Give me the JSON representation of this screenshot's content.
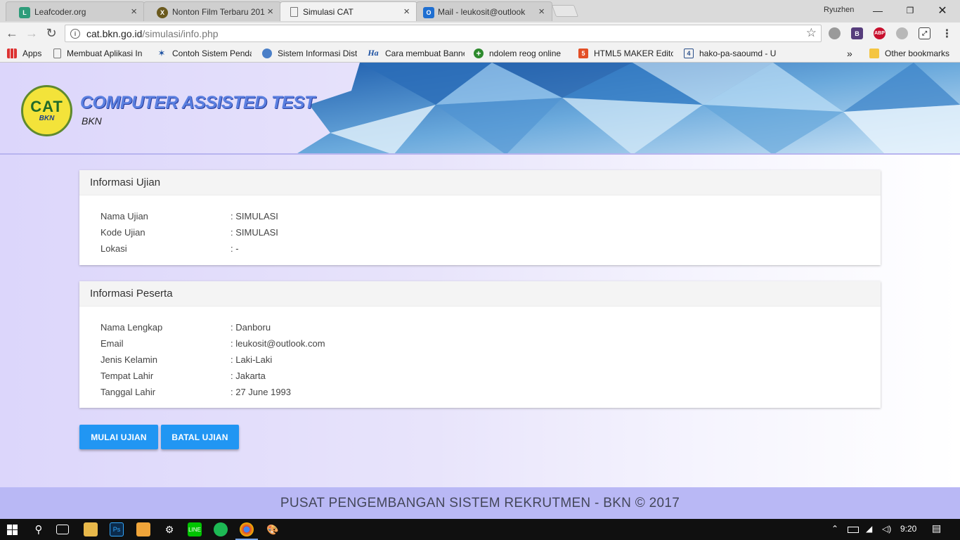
{
  "browser": {
    "tabs": [
      {
        "label": "Leafcoder.org",
        "icon": "leafcoder-icon",
        "color": "#2e9c7a",
        "active": false
      },
      {
        "label": "Nonton Film Terbaru 201",
        "icon": "film-icon",
        "color": "#6b5a1e",
        "active": false
      },
      {
        "label": "Simulasi CAT",
        "icon": "page-icon",
        "color": "#999999",
        "active": true
      },
      {
        "label": "Mail - leukosit@outlook",
        "icon": "outlook-icon",
        "color": "#1f6fd1",
        "active": false
      }
    ],
    "user": "Ryuzhen",
    "url": {
      "host": "cat.bkn.go.id",
      "path": "/simulasi/info.php"
    },
    "bookmarks": [
      {
        "label": "Apps",
        "icon": "apps-icon"
      },
      {
        "label": "Membuat Aplikasi In",
        "icon": "page-icon"
      },
      {
        "label": "Contoh Sistem Penda",
        "icon": "star-icon"
      },
      {
        "label": "Sistem Informasi Dist",
        "icon": "globe-icon"
      },
      {
        "label": "Cara membuat Banne",
        "icon": "ha-icon"
      },
      {
        "label": "ndolem reog online",
        "icon": "plus-icon"
      },
      {
        "label": "HTML5 MAKER Edito",
        "icon": "html5-icon"
      },
      {
        "label": "hako-pa-saoumd - U",
        "icon": "four-icon"
      }
    ],
    "more_bookmarks": "»",
    "other_bookmarks": "Other bookmarks"
  },
  "header": {
    "logo_text": "CAT",
    "logo_sub": "BKN",
    "title": "COMPUTER ASSISTED TEST",
    "subtitle": "BKN"
  },
  "exam_info": {
    "heading": "Informasi Ujian",
    "rows": [
      {
        "label": "Nama Ujian",
        "value": ": SIMULASI"
      },
      {
        "label": "Kode Ujian",
        "value": ": SIMULASI"
      },
      {
        "label": "Lokasi",
        "value": ": -"
      }
    ]
  },
  "participant_info": {
    "heading": "Informasi Peserta",
    "rows": [
      {
        "label": "Nama Lengkap",
        "value": ": Danboru"
      },
      {
        "label": "Email",
        "value": ": leukosit@outlook.com"
      },
      {
        "label": "Jenis Kelamin",
        "value": ": Laki-Laki"
      },
      {
        "label": "Tempat Lahir",
        "value": ": Jakarta"
      },
      {
        "label": "Tanggal Lahir",
        "value": ": 27 June 1993"
      }
    ]
  },
  "actions": {
    "start": "MULAI UJIAN",
    "cancel": "BATAL UJIAN"
  },
  "footer": {
    "text": "PUSAT PENGEMBANGAN SISTEM REKRUTMEN - BKN © 2017"
  },
  "taskbar": {
    "clock": "9:20"
  },
  "colors": {
    "primary_button": "#2196f3",
    "footer_bg": "#b9b8f5",
    "title_blue": "#5a7fe0"
  }
}
